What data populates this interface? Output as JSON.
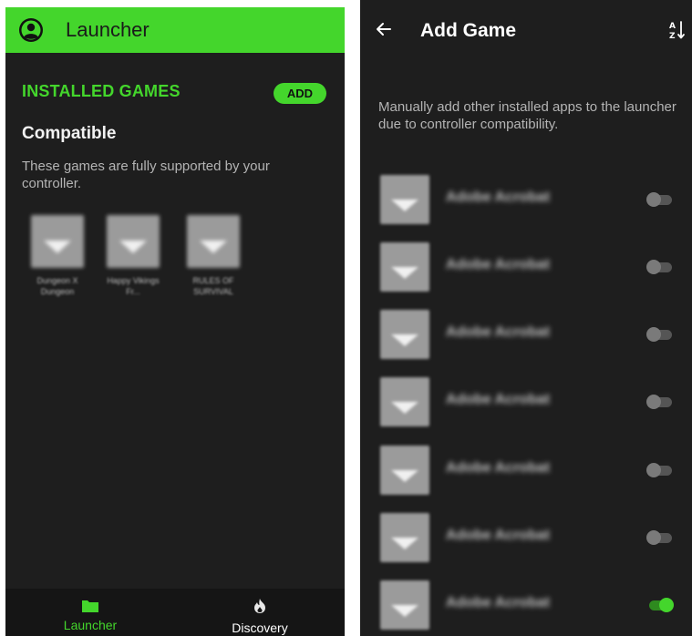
{
  "left": {
    "header": {
      "title": "Launcher",
      "avatar_icon": "account-circle-icon"
    },
    "installed_heading": "INSTALLED GAMES",
    "add_label": "ADD",
    "compatible_heading": "Compatible",
    "compatible_desc": "These games are fully supported by your controller.",
    "games": [
      {
        "name": "Dungeon X Dungeon"
      },
      {
        "name": "Happy Vikings Fr..."
      },
      {
        "name": "RULES OF SURVIVAL"
      }
    ],
    "nav": [
      {
        "label": "Launcher",
        "icon": "folder-icon",
        "active": true
      },
      {
        "label": "Discovery",
        "icon": "fire-icon",
        "active": false
      }
    ]
  },
  "right": {
    "title": "Add Game",
    "back_icon": "arrow-back-icon",
    "sort_icon": "sort-alpha-icon",
    "description": "Manually add other installed apps to the launcher due to controller compatibility.",
    "apps": [
      {
        "name": "Adobe Acrobat",
        "enabled": false
      },
      {
        "name": "Adobe Acrobat",
        "enabled": false
      },
      {
        "name": "Adobe Acrobat",
        "enabled": false
      },
      {
        "name": "Adobe Acrobat",
        "enabled": false
      },
      {
        "name": "Adobe Acrobat",
        "enabled": false
      },
      {
        "name": "Adobe Acrobat",
        "enabled": false
      },
      {
        "name": "Adobe Acrobat",
        "enabled": true
      }
    ]
  },
  "colors": {
    "accent": "#44d62c",
    "background": "#1e1e1e",
    "nav_background": "#151515",
    "inactive_text": "#ffffff"
  }
}
